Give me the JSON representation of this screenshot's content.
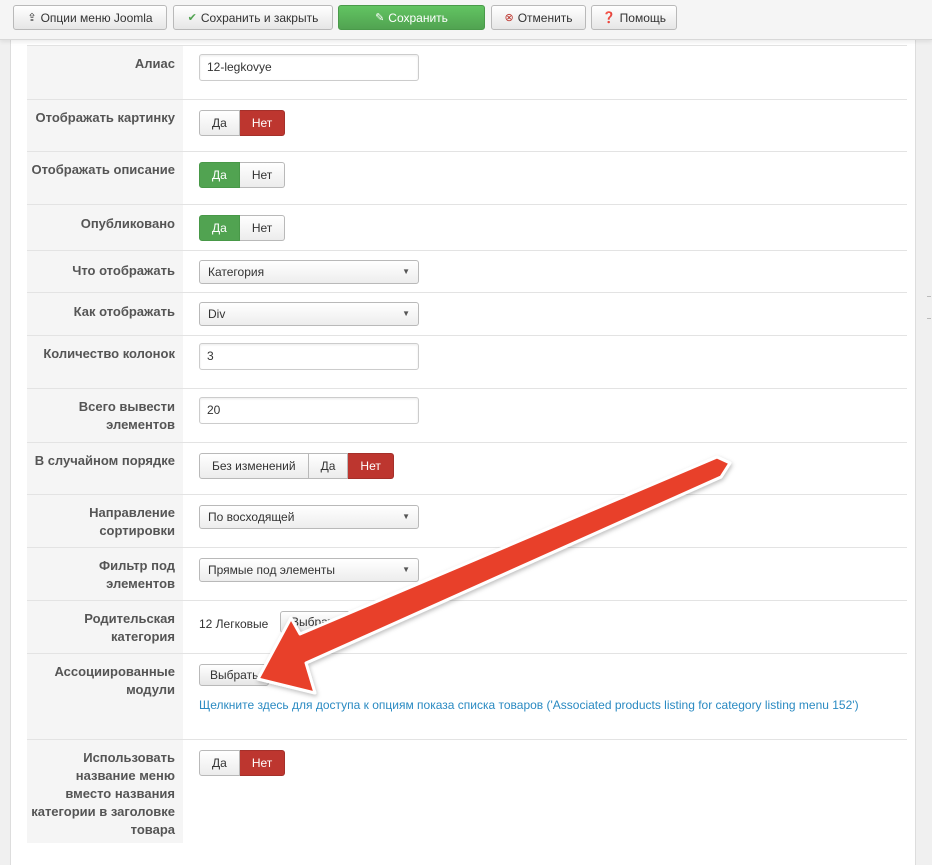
{
  "toolbar": {
    "options": "Опции меню Joomla",
    "save_close": "Сохранить и закрыть",
    "save": "Сохранить",
    "cancel": "Отменить",
    "help": "Помощь"
  },
  "fields": {
    "alias": {
      "label": "Алиас",
      "value": "12-legkovye"
    },
    "show_image": {
      "label": "Отображать картинку",
      "yes": "Да",
      "no": "Нет"
    },
    "show_desc": {
      "label": "Отображать описание",
      "yes": "Да",
      "no": "Нет"
    },
    "published": {
      "label": "Опубликовано",
      "yes": "Да",
      "no": "Нет"
    },
    "what_show": {
      "label": "Что отображать",
      "value": "Категория"
    },
    "how_show": {
      "label": "Как отображать",
      "value": "Div"
    },
    "columns": {
      "label": "Количество колонок",
      "value": "3"
    },
    "total": {
      "label": "Всего вывести элементов",
      "value": "20"
    },
    "random": {
      "label": "В случайном порядке",
      "opt1": "Без изменений",
      "opt2": "Да",
      "opt3": "Нет"
    },
    "sort_dir": {
      "label": "Направление сортировки",
      "value": "По восходящей"
    },
    "filter": {
      "label": "Фильтр под элементов",
      "value": "Прямые под элементы"
    },
    "parent_cat": {
      "label": "Родительская категория",
      "value": "12 Легковые",
      "button": "Выбрать"
    },
    "assoc": {
      "label": "Ассоциированные модули",
      "button": "Выбрать",
      "link": "Щелкните здесь для доступа к опциям показа списка товаров ('Associated products listing for category listing menu 152')"
    },
    "use_menu_name": {
      "label": "Использовать название меню вместо названия категории в заголовке товара",
      "yes": "Да",
      "no": "Нет"
    }
  },
  "colors": {
    "green": "#51a351",
    "red": "#bd362f",
    "link": "#2a8ac2",
    "arrow": "#e8412c"
  }
}
